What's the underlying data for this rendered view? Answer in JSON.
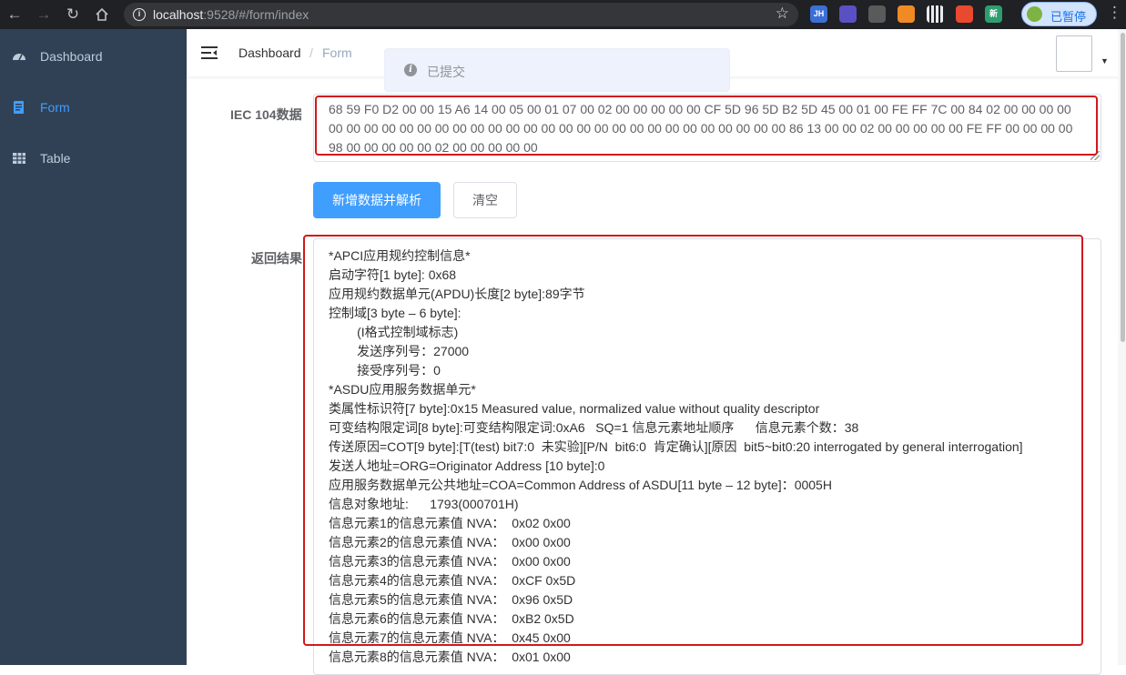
{
  "browser": {
    "url_host": "localhost",
    "url_rest": ":9528/#/form/index",
    "profile_label": "已暂停",
    "extensions": [
      {
        "name": "jh-extension-icon",
        "text": "JH",
        "color": "#3b6fd6"
      },
      {
        "name": "purple-extension-icon",
        "text": "",
        "color": "#5b4fc4"
      },
      {
        "name": "react-extension-icon",
        "text": "",
        "color": "#5a5a5a"
      },
      {
        "name": "orange-extension-icon",
        "text": "",
        "color": "#f08a24"
      },
      {
        "name": "qr-code-icon",
        "text": "",
        "color": "#e8eaed"
      },
      {
        "name": "red-extension-icon",
        "text": "",
        "color": "#e8492f"
      },
      {
        "name": "new-extension-icon",
        "text": "新",
        "color": "#2e9e6f"
      }
    ]
  },
  "sidebar": {
    "items": [
      {
        "label": "Dashboard",
        "icon": "dashboard-icon",
        "active": false
      },
      {
        "label": "Form",
        "icon": "form-icon",
        "active": true
      },
      {
        "label": "Table",
        "icon": "table-icon",
        "active": false
      }
    ]
  },
  "navbar": {
    "breadcrumb_root": "Dashboard",
    "breadcrumb_sep": "/",
    "breadcrumb_leaf": "Form"
  },
  "toast": {
    "text": "已提交"
  },
  "form": {
    "iec_label": "IEC 104数据",
    "iec_value": "68 59 F0 D2 00 00 15 A6 14 00 05 00 01 07 00 02 00 00 00 00 00 CF 5D 96 5D B2 5D 45 00 01 00 FE FF 7C 00 84 02 00 00 00 00 00 00 00 00 00 00 00 00 00 00 00 00 00 00 00 00 00 00 00 00 00 00 00 00 00 00 86 13 00 00 02 00 00 00 00 00 FE FF 00 00 00 00 98 00 00 00 00 00 02 00 00 00 00 00",
    "submit_label": "新增数据并解析",
    "clear_label": "清空",
    "result_label": "返回结果"
  },
  "result_lines": [
    "*APCI应用规约控制信息*",
    "启动字符[1 byte]: 0x68",
    "应用规约数据单元(APDU)长度[2 byte]:89字节",
    "控制域[3 byte – 6 byte]:",
    "        (I格式控制域标志)",
    "        发送序列号：27000",
    "        接受序列号：0",
    "*ASDU应用服务数据单元*",
    "类属性标识符[7 byte]:0x15 Measured value, normalized value without quality descriptor",
    "可变结构限定词[8 byte]:可变结构限定词:0xA6   SQ=1 信息元素地址顺序      信息元素个数：38",
    "传送原因=COT[9 byte]:[T(test) bit7:0  未实验][P/N  bit6:0  肯定确认][原因  bit5~bit0:20 interrogated by general interrogation]",
    "发送人地址=ORG=Originator Address [10 byte]:0",
    "应用服务数据单元公共地址=COA=Common Address of ASDU[11 byte – 12 byte]：0005H",
    "信息对象地址:      1793(000701H)",
    "信息元素1的信息元素值 NVA：  0x02 0x00",
    "信息元素2的信息元素值 NVA：  0x00 0x00",
    "信息元素3的信息元素值 NVA：  0x00 0x00",
    "信息元素4的信息元素值 NVA：  0xCF 0x5D",
    "信息元素5的信息元素值 NVA：  0x96 0x5D",
    "信息元素6的信息元素值 NVA：  0xB2 0x5D",
    "信息元素7的信息元素值 NVA：  0x45 0x00",
    "信息元素8的信息元素值 NVA：  0x01 0x00"
  ],
  "colors": {
    "sidebar_bg": "#304156",
    "accent": "#409eff",
    "highlight": "#d0191c"
  }
}
